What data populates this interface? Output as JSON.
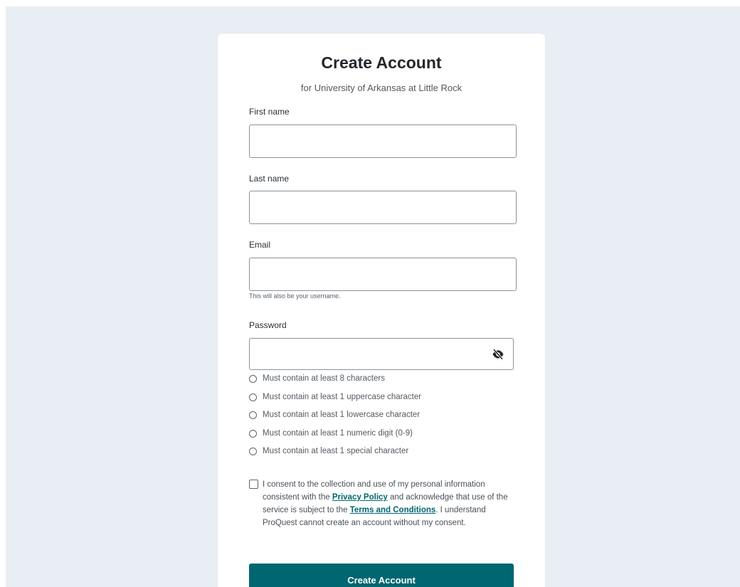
{
  "page": {
    "title": "Create Account",
    "subtitle": "for University of Arkansas at Little Rock"
  },
  "form": {
    "first_name": {
      "label": "First name",
      "value": ""
    },
    "last_name": {
      "label": "Last name",
      "value": ""
    },
    "email": {
      "label": "Email",
      "value": "",
      "hint": "This will also be your username."
    },
    "password": {
      "label": "Password",
      "value": "",
      "toggle_icon": "eye-slash-icon"
    }
  },
  "password_rules": [
    "Must contain at least 8 characters",
    "Must contain at least 1 uppercase character",
    "Must contain at least 1 lowercase character",
    "Must contain at least 1 numeric digit (0-9)",
    "Must contain at least 1 special character"
  ],
  "consent": {
    "checked": false,
    "text_before_privacy": "I consent to the collection and use of my personal information consistent with the ",
    "privacy_link": "Privacy Policy",
    "text_between": " and acknowledge that use of the service is subject to the ",
    "terms_link": "Terms and Conditions",
    "text_after": ". I understand ProQuest cannot create an account without my consent."
  },
  "submit_label": "Create Account",
  "colors": {
    "background": "#e8eef4",
    "accent": "#006670",
    "card": "#ffffff"
  }
}
